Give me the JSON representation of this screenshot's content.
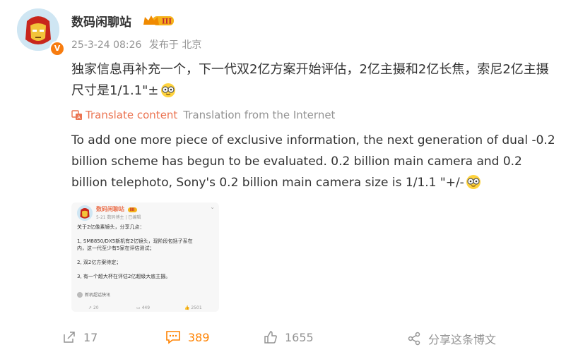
{
  "post": {
    "username": "数码闲聊站",
    "level_badge": "III",
    "timestamp": "25-3-24 08:26",
    "location_label": "发布于 北京",
    "text": "独家信息再补充一个，下一代双2亿方案开始评估，2亿主摄和2亿长焦，索尼2亿主摄尺寸是1/1.1\"±",
    "translate_link": "Translate content",
    "translate_source": "Translation from the Internet",
    "translated_text": "To add one more piece of exclusive information, the next generation of dual -0.2 billion scheme has begun to be evaluated. 0.2 billion main camera and 0.2 billion telephoto, Sony's 0.2 billion main camera size is 1/1.1 \"+/-"
  },
  "embedded": {
    "username": "数码闲聊站",
    "badge": "III",
    "meta": "5-21  数码博主 | 已编辑",
    "lines": [
      "关于2亿像素镜头，分享几点：",
      "1, SM8850/DX5新机有2亿镜头，现阶段包括子系在\n内，这一代至少有5家在评估测试；",
      "2, 双2亿方案待定；",
      "3, 有一个超大杯在评估2亿超级大底主摄。"
    ],
    "tag": "新机超话快讯",
    "reposts": "20",
    "comments": "449",
    "likes": "2501"
  },
  "footer": {
    "reposts": "17",
    "comments": "389",
    "likes": "1655",
    "share": "分享这条博文"
  },
  "colors": {
    "accent": "#ff8200",
    "translate": "#eb7350",
    "meta": "#939393",
    "verified": "#f77c0f"
  },
  "icons": [
    "repost-icon",
    "comment-icon",
    "like-icon",
    "share-icon",
    "translate-icon",
    "crown-badge-icon",
    "emoji-glasses-icon"
  ]
}
